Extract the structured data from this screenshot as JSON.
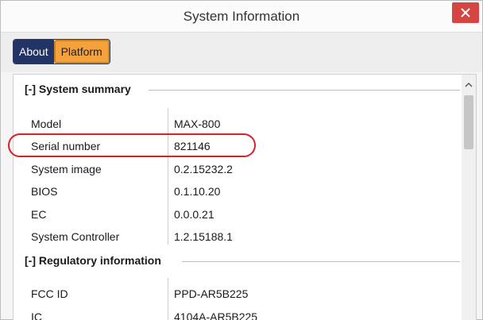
{
  "window": {
    "title": "System Information"
  },
  "tabs": [
    {
      "label": "About",
      "active": false
    },
    {
      "label": "Platform",
      "active": true
    }
  ],
  "sections": {
    "system_summary": {
      "header": "[-] System summary",
      "rows": [
        {
          "label": "Model",
          "value": "MAX-800"
        },
        {
          "label": "Serial number",
          "value": "821146"
        },
        {
          "label": "System image",
          "value": "0.2.15232.2"
        },
        {
          "label": "BIOS",
          "value": "0.1.10.20"
        },
        {
          "label": "EC",
          "value": "0.0.0.21"
        },
        {
          "label": "System Controller",
          "value": "1.2.15188.1"
        }
      ]
    },
    "regulatory": {
      "header": "[-] Regulatory information",
      "rows": [
        {
          "label": "FCC ID",
          "value": "PPD-AR5B225"
        },
        {
          "label": "IC",
          "value": "4104A-AR5B225"
        }
      ]
    }
  },
  "colors": {
    "tab_active": "#f6a23c",
    "tab_inactive": "#223365",
    "close_button": "#d64541",
    "highlight": "#d6202a"
  }
}
